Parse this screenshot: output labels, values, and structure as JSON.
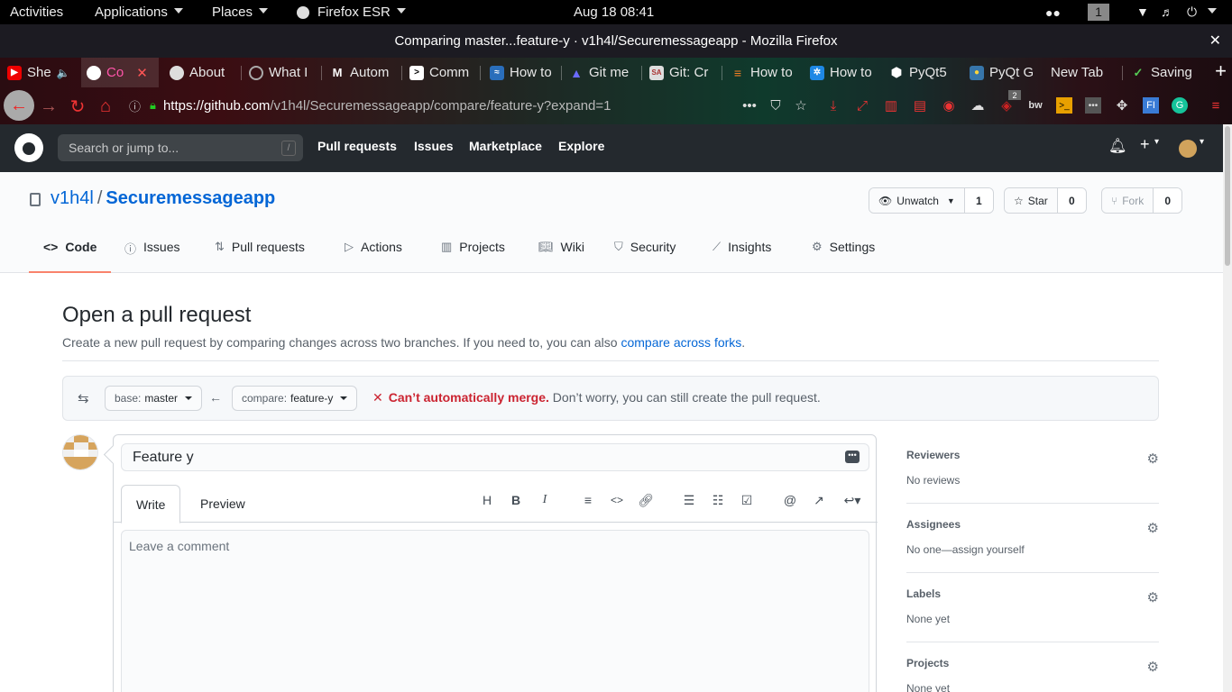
{
  "gnome": {
    "activities": "Activities",
    "applications": "Applications",
    "places": "Places",
    "app": "Firefox ESR",
    "datetime": "Aug 18  08:41",
    "workspace": "1"
  },
  "firefox": {
    "window_title": "Comparing master...feature-y · v1h4l/Securemessageapp - Mozilla Firefox",
    "tabs": [
      {
        "label": "She",
        "icon": "youtube-icon"
      },
      {
        "label": "Co",
        "icon": "github-icon"
      },
      {
        "label": "About",
        "icon": "github-icon"
      },
      {
        "label": "What I",
        "icon": "circle-icon"
      },
      {
        "label": "Autom",
        "icon": "medium-icon"
      },
      {
        "label": "Comm",
        "icon": "terminal-icon"
      },
      {
        "label": "How to",
        "icon": "stackexchange-icon"
      },
      {
        "label": "Git me",
        "icon": "atlassian-icon"
      },
      {
        "label": "Git: Cr",
        "icon": "sa-icon"
      },
      {
        "label": "How to",
        "icon": "stackoverflow-icon"
      },
      {
        "label": "How to",
        "icon": "react-icon"
      },
      {
        "label": "PyQt5",
        "icon": "hexagon-icon"
      },
      {
        "label": "PyQt G",
        "icon": "python-icon"
      },
      {
        "label": "New Tab",
        "icon": ""
      },
      {
        "label": "Saving",
        "icon": "saving-icon"
      }
    ],
    "url_host": "https://github.com",
    "url_path": "/v1h4l/Securemessageapp/compare/feature-y?expand=1",
    "ublock_badge": "2"
  },
  "github": {
    "search_placeholder": "Search or jump to...",
    "search_key": "/",
    "nav": [
      "Pull requests",
      "Issues",
      "Marketplace",
      "Explore"
    ],
    "repo_owner": "v1h4l",
    "repo_name": "Securemessageapp",
    "unwatch_label": "Unwatch",
    "watch_count": "1",
    "star_label": "Star",
    "star_count": "0",
    "fork_label": "Fork",
    "fork_count": "0",
    "repo_tabs": [
      "Code",
      "Issues",
      "Pull requests",
      "Actions",
      "Projects",
      "Wiki",
      "Security",
      "Insights",
      "Settings"
    ],
    "page_title": "Open a pull request",
    "page_sub": "Create a new pull request by comparing changes across two branches. If you need to, you can also ",
    "page_sub_link": "compare across forks",
    "page_sub_end": ".",
    "base_key": "base:",
    "base_value": "master",
    "compare_key": "compare:",
    "compare_value": "feature-y",
    "merge_bad": "Can’t automatically merge.",
    "merge_note": " Don’t worry, you can still create the pull request.",
    "pr_title_value": "Feature y",
    "tab_write": "Write",
    "tab_preview": "Preview",
    "comment_placeholder": "Leave a comment",
    "sidebar": {
      "reviewers": "Reviewers",
      "reviewers_value": "No reviews",
      "assignees": "Assignees",
      "assignees_value": "No one—assign yourself",
      "labels": "Labels",
      "labels_value": "None yet",
      "projects": "Projects",
      "projects_value": "None yet"
    }
  },
  "colors": {
    "link": "#0366d6",
    "merge_error": "#cb2431",
    "active_tab_underline": "#f9826c",
    "header_bg": "#24292e"
  }
}
